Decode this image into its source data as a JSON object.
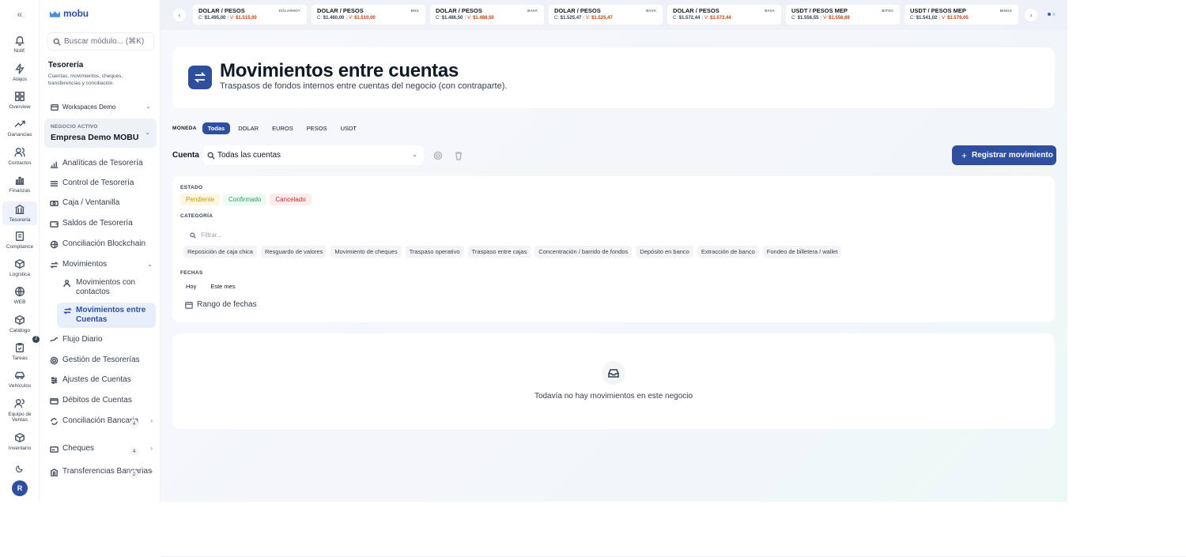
{
  "app": {
    "logo": "mobu"
  },
  "rail": [
    {
      "label": "Notif.",
      "icon": "bell-icon"
    },
    {
      "label": "Atajos",
      "icon": "shortcuts-icon"
    },
    {
      "label": "Overview",
      "icon": "overview-icon"
    },
    {
      "label": "Ganancias",
      "icon": "trend-icon"
    },
    {
      "label": "Contactos",
      "icon": "contacts-icon"
    },
    {
      "label": "Finanzas",
      "icon": "finance-icon"
    },
    {
      "label": "Tesorería",
      "icon": "bank-icon"
    },
    {
      "label": "Compliance",
      "icon": "compliance-icon"
    },
    {
      "label": "Logística",
      "icon": "box-icon"
    },
    {
      "label": "WEB",
      "icon": "globe-icon"
    },
    {
      "label": "Catálogo",
      "icon": "catalog-icon"
    },
    {
      "label": "Tareas",
      "icon": "tasks-icon"
    },
    {
      "label": "Vehículos",
      "icon": "vehicle-icon"
    },
    {
      "label": "Equipo de Ventas",
      "icon": "team-icon"
    },
    {
      "label": "Inventario",
      "icon": "inventory-icon"
    }
  ],
  "rail_badge": "2",
  "user": {
    "initial": "R"
  },
  "sidebar": {
    "search_placeholder": "Buscar módulo... (⌘K)",
    "section_title": "Tesorería",
    "section_desc": "Cuentas, movimientos, cheques, transferencias y conciliación.",
    "workspace": "Workspaces Demo",
    "business_label": "NEGOCIO ACTIVO",
    "business_name": "Empresa Demo MOBU",
    "items": [
      {
        "label": "Analíticas de Tesorería"
      },
      {
        "label": "Control de Tesorería"
      },
      {
        "label": "Caja / Ventanilla"
      },
      {
        "label": "Saldos de Tesorería"
      },
      {
        "label": "Conciliación Blockchain"
      },
      {
        "label": "Movimientos"
      },
      {
        "label": "Movimientos con contactos"
      },
      {
        "label": "Movimientos entre Cuentas"
      },
      {
        "label": "Flujo Diario"
      },
      {
        "label": "Gestión de Tesorerías"
      },
      {
        "label": "Ajustes de Cuentas"
      },
      {
        "label": "Débitos de Cuentas"
      },
      {
        "label": "Conciliación Bancaria",
        "count": "4"
      },
      {
        "label": "Cheques",
        "count": "4"
      },
      {
        "label": "Transferencias Bancarias",
        "count": "2"
      }
    ]
  },
  "ticker": [
    {
      "pair": "DOLAR / PESOS",
      "source": "DÓLARHOY",
      "c": "$1.495,00",
      "v": "$1.515,00"
    },
    {
      "pair": "DOLAR / PESOS",
      "source": "BNA",
      "c": "$1.460,00",
      "v": "$1.510,00"
    },
    {
      "pair": "DOLAR / PESOS",
      "source": "BAVA",
      "c": "$1.486,50",
      "v": "$1.486,50"
    },
    {
      "pair": "DOLAR / PESOS",
      "source": "BAVA",
      "c": "$1.525,47",
      "v": "$1.525,47"
    },
    {
      "pair": "DOLAR / PESOS",
      "source": "BAVA",
      "c": "$1.572,44",
      "v": "$1.572,44"
    },
    {
      "pair": "USDT / PESOS MEP",
      "source": "BITSO",
      "c": "$1.556,55",
      "v": "$1.556,69"
    },
    {
      "pair": "USDT / PESOS MEP",
      "source": "BINGX",
      "c": "$1.541,02",
      "v": "$1.579,05"
    }
  ],
  "ticker_labels": {
    "c": "C:",
    "v": "V:",
    "sep": "|"
  },
  "header": {
    "title": "Movimientos entre cuentas",
    "subtitle": "Traspasos de fondos internos entre cuentas del negocio (con contraparte)."
  },
  "currency": {
    "label": "MONEDA",
    "options": [
      "Todas",
      "DOLAR",
      "EUROS",
      "PESOS",
      "USDT"
    ],
    "selected": "Todas"
  },
  "account": {
    "label": "Cuenta",
    "value": "Todas las cuentas",
    "register_button": "Registrar movimiento"
  },
  "filters": {
    "status_label": "ESTADO",
    "statuses": [
      "Pendiente",
      "Confirmado",
      "Cancelado"
    ],
    "category_label": "CATEGORÍA",
    "category_placeholder": "Filtrar...",
    "categories": [
      "Reposición de caja chica",
      "Resguardo de valores",
      "Movimiento de cheques",
      "Traspaso operativo",
      "Traspaso entre cajas",
      "Concentración / barrido de fondos",
      "Depósito en banco",
      "Extracción de banco",
      "Fondeo de billetera / wallet"
    ],
    "dates_label": "FECHAS",
    "dates": [
      "Hoy",
      "Este mes"
    ],
    "range_label": "Rango de fechas"
  },
  "empty": {
    "text": "Todavía no hay movimientos en este negocio"
  },
  "colors": {
    "primary": "#2d4f9e",
    "pending": "#c79a0b",
    "confirmed": "#2f9e60",
    "cancelled": "#c53030"
  }
}
